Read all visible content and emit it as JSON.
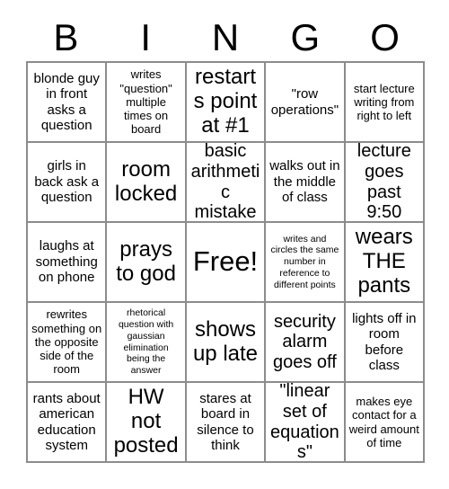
{
  "card": {
    "title": "BINGO",
    "header_letters": [
      "B",
      "I",
      "N",
      "G",
      "O"
    ],
    "rows": [
      [
        {
          "text": "blonde guy in front asks a question",
          "size": "m"
        },
        {
          "text": "writes \"question\" multiple times on board",
          "size": "s"
        },
        {
          "text": "restarts point at #1",
          "size": "xl"
        },
        {
          "text": "\"row operations\"",
          "size": "m"
        },
        {
          "text": "start lecture writing from right to left",
          "size": "s"
        }
      ],
      [
        {
          "text": "girls in back ask a question",
          "size": "m"
        },
        {
          "text": "room locked",
          "size": "xl"
        },
        {
          "text": "basic arithmetic mistake",
          "size": "l"
        },
        {
          "text": "walks out in the middle of class",
          "size": "m"
        },
        {
          "text": "lecture goes past 9:50",
          "size": "l"
        }
      ],
      [
        {
          "text": "laughs at something on phone",
          "size": "m"
        },
        {
          "text": "prays to god",
          "size": "xl"
        },
        {
          "text": "Free!",
          "size": "free"
        },
        {
          "text": "writes and circles the same number in reference to different points",
          "size": "xs"
        },
        {
          "text": "wears THE pants",
          "size": "xl"
        }
      ],
      [
        {
          "text": "rewrites something on the opposite side of the room",
          "size": "s"
        },
        {
          "text": "rhetorical question with gaussian elimination being the answer",
          "size": "xs"
        },
        {
          "text": "shows up late",
          "size": "xl"
        },
        {
          "text": "security alarm goes off",
          "size": "l"
        },
        {
          "text": "lights off in room before class",
          "size": "m"
        }
      ],
      [
        {
          "text": "rants about american education system",
          "size": "m"
        },
        {
          "text": "HW not posted",
          "size": "xl"
        },
        {
          "text": "stares at board in silence to think",
          "size": "m"
        },
        {
          "text": "\"linear set of equations\"",
          "size": "l"
        },
        {
          "text": "makes eye contact for a weird amount of time",
          "size": "s"
        }
      ]
    ]
  },
  "colors": {
    "background": "#ffffff",
    "text": "#000000",
    "grid_line": "#8c8c8c"
  }
}
